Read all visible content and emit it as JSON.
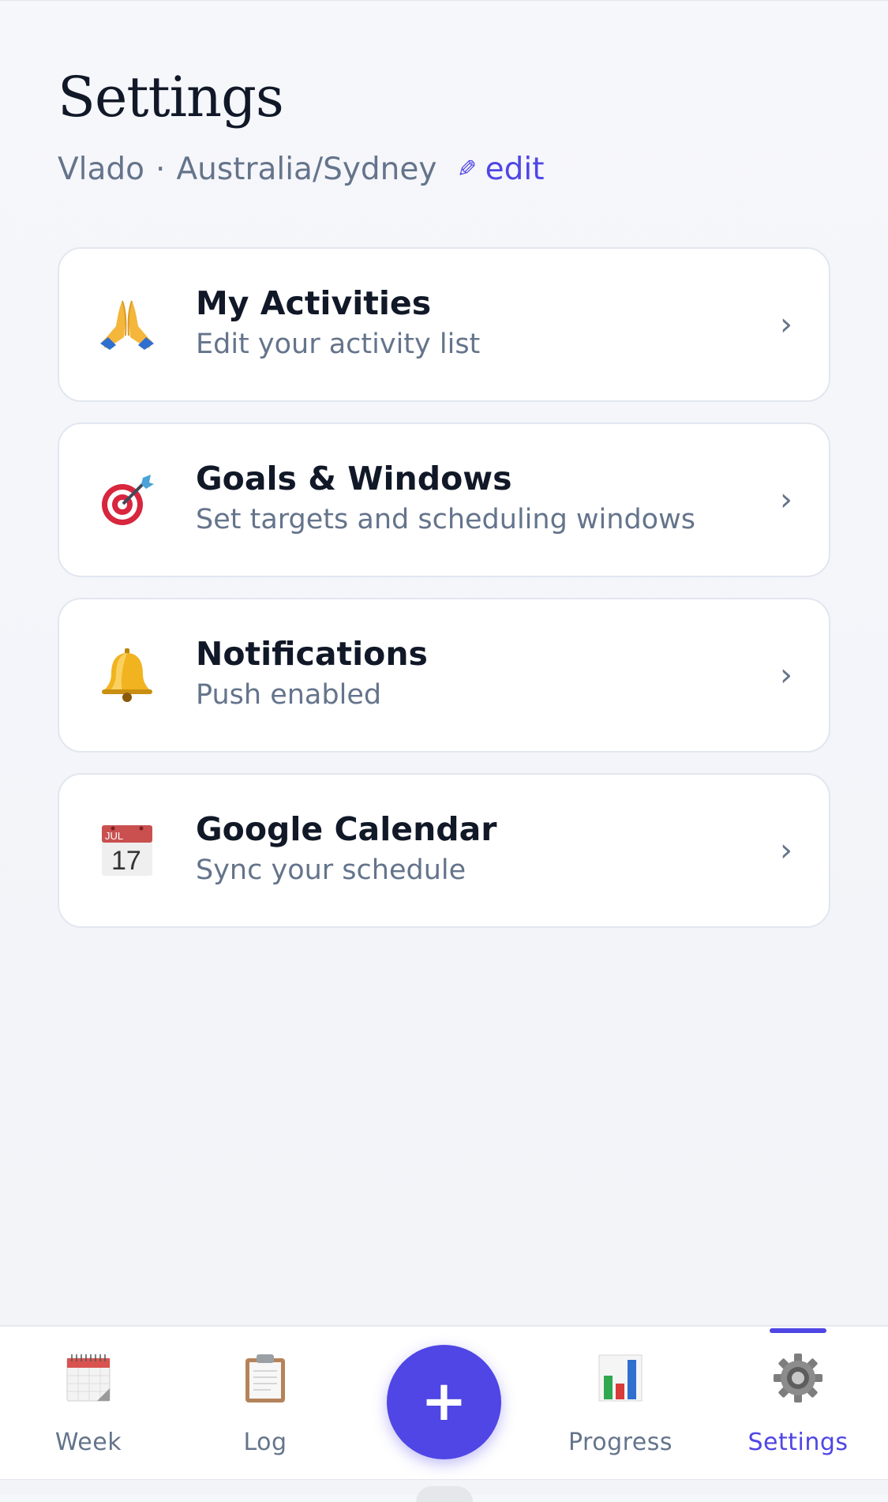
{
  "header": {
    "title": "Settings",
    "user_name": "Vlado",
    "separator": "·",
    "timezone": "Australia/Sydney",
    "edit_icon": "pencil-icon",
    "edit_label": "edit"
  },
  "cards": [
    {
      "icon": "folded-hands-icon",
      "title": "My Activities",
      "subtitle": "Edit your activity list"
    },
    {
      "icon": "target-icon",
      "title": "Goals & Windows",
      "subtitle": "Set targets and scheduling windows"
    },
    {
      "icon": "bell-icon",
      "title": "Notifications",
      "subtitle": "Push enabled"
    },
    {
      "icon": "calendar-icon",
      "title": "Google Calendar",
      "subtitle": "Sync your schedule",
      "calendar_month": "JUL",
      "calendar_day": "17"
    }
  ],
  "chevron": "›",
  "tabbar": {
    "tabs": [
      {
        "icon": "calendar-week-icon",
        "label": "Week",
        "active": false
      },
      {
        "icon": "clipboard-icon",
        "label": "Log",
        "active": false
      },
      {
        "icon": "bar-chart-icon",
        "label": "Progress",
        "active": false
      },
      {
        "icon": "gear-icon",
        "label": "Settings",
        "active": true
      }
    ],
    "fab_label": "+"
  },
  "colors": {
    "accent": "#4f46e5",
    "text_primary": "#111827",
    "text_secondary": "#64748b",
    "card_border": "#e2e6ef",
    "background": "#f4f5f9"
  }
}
